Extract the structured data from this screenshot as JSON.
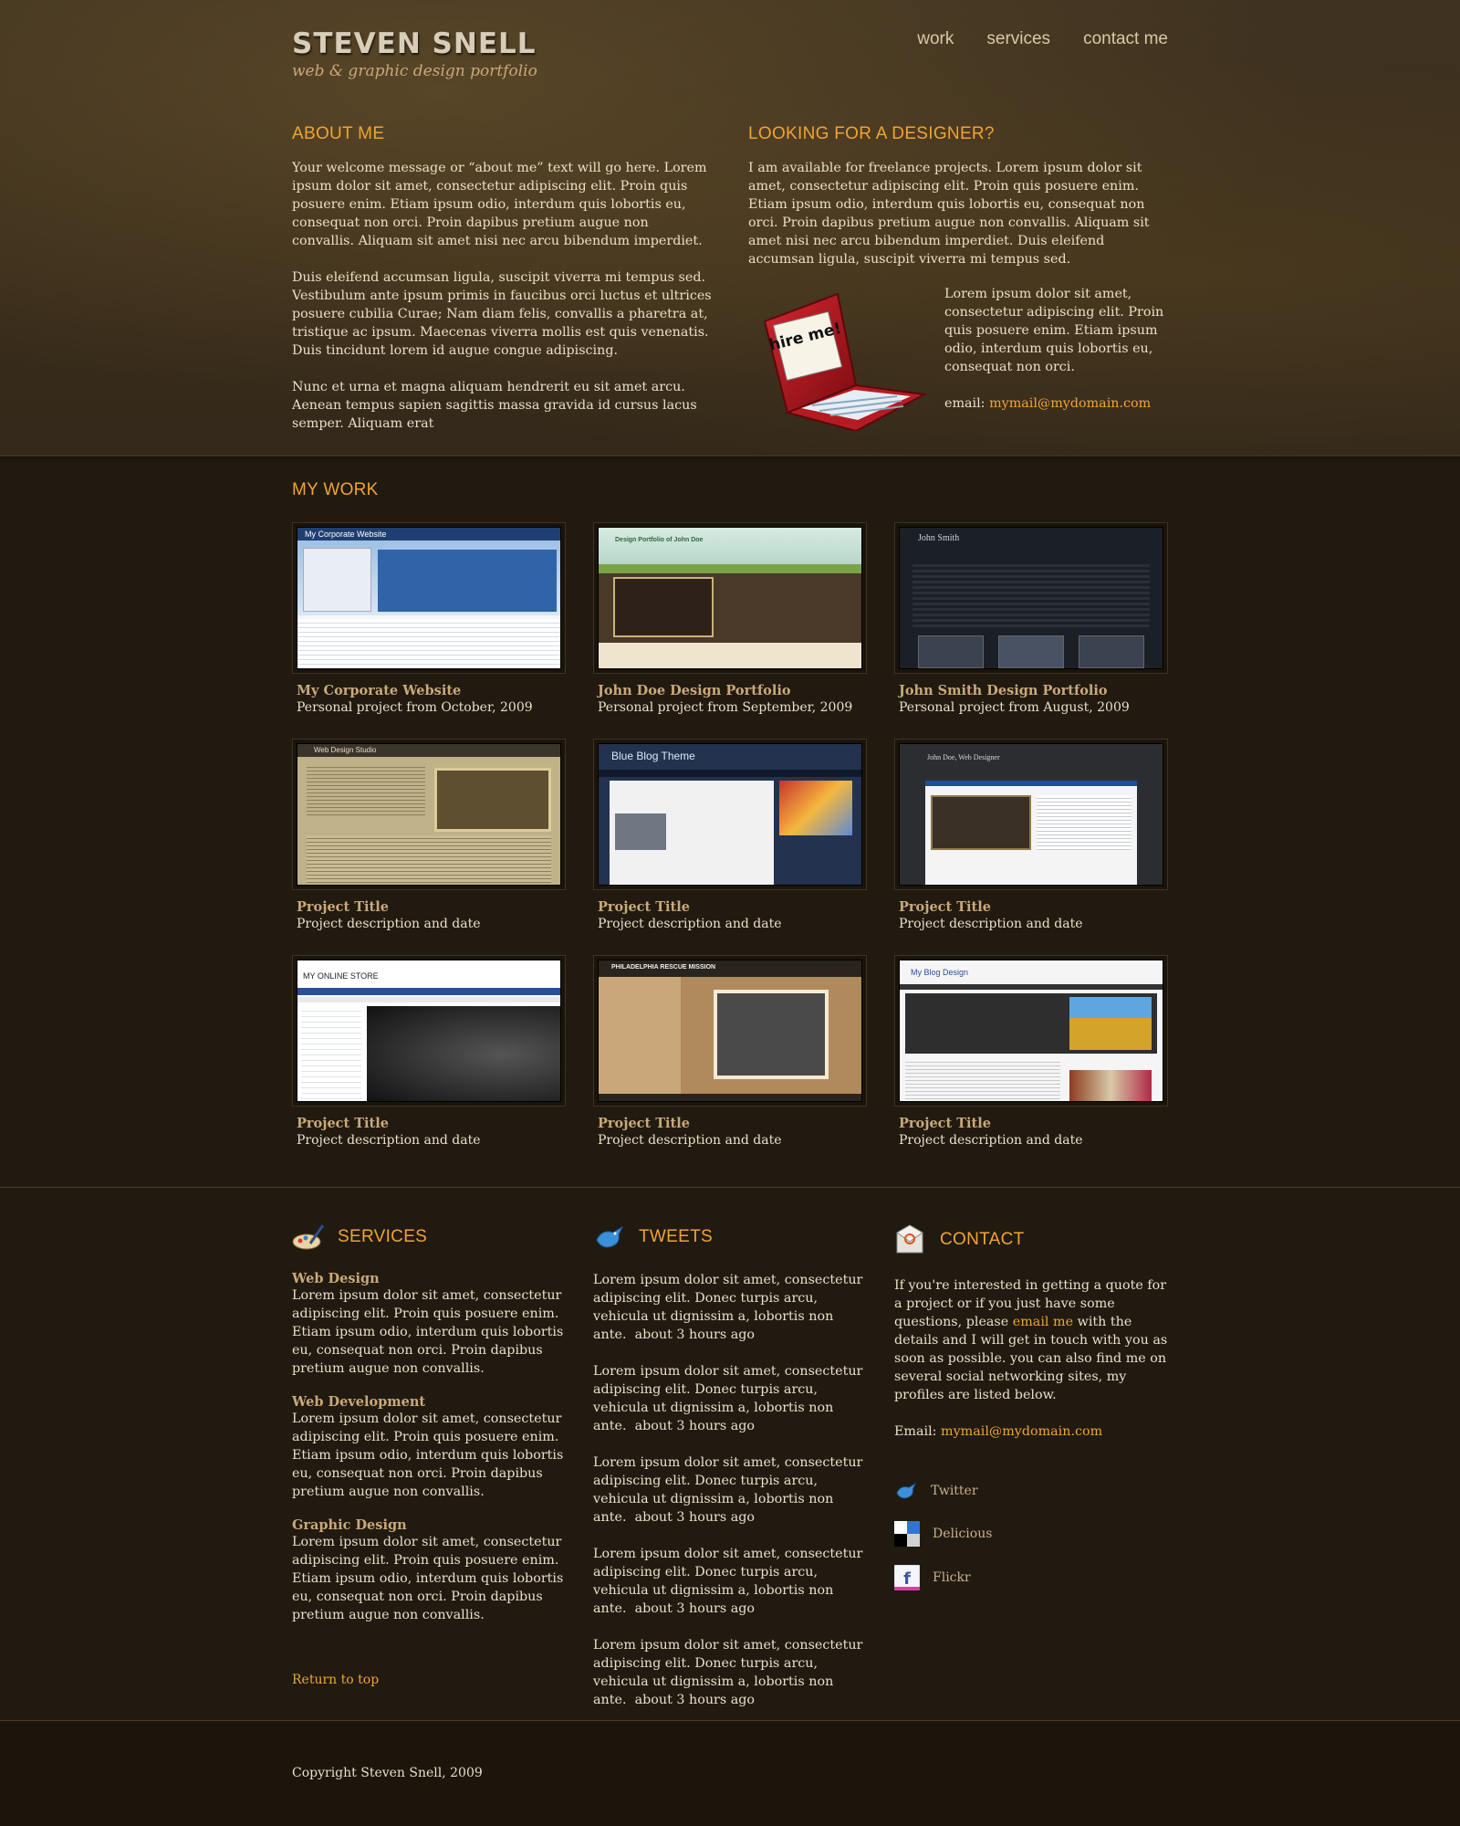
{
  "brand": {
    "name": "STEVEN SNELL",
    "tagline": "web & graphic design portfolio"
  },
  "nav": {
    "items": [
      "work",
      "services",
      "contact me"
    ]
  },
  "about": {
    "heading": "ABOUT ME",
    "paragraphs": [
      "Your welcome message or “about me” text will go here. Lorem ipsum dolor sit amet, consectetur adipiscing elit. Proin quis posuere enim. Etiam ipsum odio, interdum quis lobortis eu, consequat non orci. Proin dapibus pretium augue non convallis. Aliquam sit amet nisi nec arcu bibendum imperdiet.",
      "Duis eleifend accumsan ligula, suscipit viverra mi tempus sed. Vestibulum ante ipsum primis in faucibus orci luctus et ultrices posuere cubilia Curae; Nam diam felis, convallis a pharetra at, tristique ac ipsum. Maecenas viverra mollis est quis venenatis. Duis tincidunt lorem id augue congue adipiscing.",
      "Nunc et urna et magna aliquam hendrerit eu sit amet arcu. Aenean tempus sapien sagittis massa gravida id cursus lacus semper. Aliquam erat"
    ]
  },
  "designer": {
    "heading": "LOOKING FOR A DESIGNER?",
    "intro": "I am available for freelance projects. Lorem ipsum dolor sit amet, consectetur adipiscing elit. Proin quis posuere enim. Etiam ipsum odio, interdum quis lobortis eu, consequat non orci. Proin dapibus pretium augue non convallis. Aliquam sit amet nisi nec arcu bibendum imperdiet. Duis eleifend accumsan ligula, suscipit viverra mi tempus sed.",
    "side_text": "Lorem ipsum dolor sit amet, consectetur adipiscing elit. Proin quis posuere enim. Etiam ipsum odio, interdum quis lobortis eu, consequat non orci.",
    "email_label": "email:",
    "email": "mymail@mydomain.com",
    "hire_sticker": "hire me!"
  },
  "work": {
    "heading": "MY WORK",
    "projects": [
      {
        "title": "My Corporate Website",
        "desc": "Personal project from October, 2009",
        "thumb_label": "My Corporate Website"
      },
      {
        "title": "John Doe Design Portfolio",
        "desc": "Personal project from September, 2009",
        "thumb_label": "Design Portfolio of John Doe"
      },
      {
        "title": "John Smith Design Portfolio",
        "desc": "Personal project from August, 2009",
        "thumb_label": "John Smith"
      },
      {
        "title": "Project Title",
        "desc": "Project description and date",
        "thumb_label": "Web Design Studio"
      },
      {
        "title": "Project Title",
        "desc": "Project description and date",
        "thumb_label": "Blue Blog Theme"
      },
      {
        "title": "Project Title",
        "desc": "Project description and date",
        "thumb_label": "John Doe, Web Designer"
      },
      {
        "title": "Project Title",
        "desc": "Project description and date",
        "thumb_label": "MY ONLINE STORE"
      },
      {
        "title": "Project Title",
        "desc": "Project description and date",
        "thumb_label": "PHILADELPHIA RESCUE MISSION"
      },
      {
        "title": "Project Title",
        "desc": "Project description and date",
        "thumb_label": "My Blog Design"
      }
    ]
  },
  "services": {
    "heading": "SERVICES",
    "items": [
      {
        "title": "Web Design",
        "text": "Lorem ipsum dolor sit amet, consectetur adipiscing elit. Proin quis posuere enim. Etiam ipsum odio, interdum quis lobortis eu, consequat non orci. Proin dapibus pretium augue non convallis."
      },
      {
        "title": "Web Development",
        "text": "Lorem ipsum dolor sit amet, consectetur adipiscing elit. Proin quis posuere enim. Etiam ipsum odio, interdum quis lobortis eu, consequat non orci. Proin dapibus pretium augue non convallis."
      },
      {
        "title": "Graphic Design",
        "text": "Lorem ipsum dolor sit amet, consectetur adipiscing elit. Proin quis posuere enim. Etiam ipsum odio, interdum quis lobortis eu, consequat non orci. Proin dapibus pretium augue non convallis."
      }
    ],
    "return_link": "Return to top"
  },
  "tweets": {
    "heading": "TWEETS",
    "items": [
      {
        "text": "Lorem ipsum dolor sit amet, consectetur adipiscing elit. Donec turpis arcu, vehicula ut dignissim a, lobortis non ante.",
        "time": "about 3 hours ago"
      },
      {
        "text": "Lorem ipsum dolor sit amet, consectetur adipiscing elit. Donec turpis arcu, vehicula ut dignissim a, lobortis non ante.",
        "time": "about 3 hours ago"
      },
      {
        "text": "Lorem ipsum dolor sit amet, consectetur adipiscing elit. Donec turpis arcu, vehicula ut dignissim a, lobortis non ante.",
        "time": "about 3 hours ago"
      },
      {
        "text": "Lorem ipsum dolor sit amet, consectetur adipiscing elit. Donec turpis arcu, vehicula ut dignissim a, lobortis non ante.",
        "time": "about 3 hours ago"
      },
      {
        "text": "Lorem ipsum dolor sit amet, consectetur adipiscing elit. Donec turpis arcu, vehicula ut dignissim a, lobortis non ante.",
        "time": "about 3 hours ago"
      }
    ]
  },
  "contact": {
    "heading": "CONTACT",
    "text_before": "If you're interested in getting a quote for a project or if you just have some questions, please",
    "email_me": "email me",
    "text_after": "with the details and I will get in touch with you as soon as possible. you can also find me on several social networking sites, my profiles are listed below.",
    "email_label": "Email:",
    "email": "mymail@mydomain.com",
    "social": [
      {
        "label": "Twitter",
        "icon": "twitter-bird-icon"
      },
      {
        "label": "Delicious",
        "icon": "delicious-icon"
      },
      {
        "label": "Flickr",
        "icon": "facebook-icon"
      }
    ]
  },
  "footer": {
    "copyright": "Copyright Steven Snell, 2009"
  },
  "colors": {
    "accent": "#f0a432",
    "link_tan": "#c9a97a",
    "background": "#211a10"
  }
}
